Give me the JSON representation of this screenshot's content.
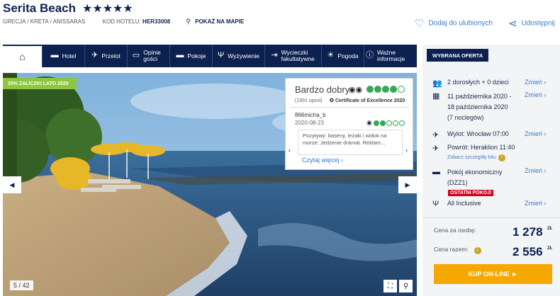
{
  "header": {
    "title": "Serita Beach",
    "stars": "★★★★★",
    "location": "GRECJA / KRETA / ANISSARAS",
    "hotel_code_label": "KOD HOTELU:",
    "hotel_code": "HER33008",
    "map_link": "POKAŻ NA MAPIE",
    "favorite": "Dodaj do ulubionych",
    "share": "Udostępnij"
  },
  "nav": {
    "items": [
      {
        "label": "Hotel",
        "icon": "bed-icon"
      },
      {
        "label": "Przelot",
        "icon": "plane-icon"
      },
      {
        "label": "Opinie gości",
        "icon": "speech-icon"
      },
      {
        "label": "Pokoje",
        "icon": "bed-icon"
      },
      {
        "label": "Wyżywienie",
        "icon": "cutlery-icon"
      },
      {
        "label": "Wycieczki fakultatywne",
        "icon": "signpost-icon"
      },
      {
        "label": "Pogoda",
        "icon": "sun-icon"
      },
      {
        "label": "Ważne informacje",
        "icon": "info-icon"
      }
    ]
  },
  "gallery": {
    "promo": "25% ZALICZKI LATO 2020",
    "counter": "5 / 42"
  },
  "review": {
    "rating_text": "Bardzo dobry",
    "rating": 4,
    "count": "(1991 opinii)",
    "certificate": "Certificate of Excellence 2020",
    "user": "866micha_b",
    "date": "2020-08-23",
    "user_rating": 2,
    "text": "Pozytywy: baseny, leżaki i widok na morze. Jedzenie dramat. Reklam...",
    "more": "Czytaj więcej"
  },
  "offer": {
    "heading": "WYBRANA OFERTA",
    "change": "Zmień",
    "guests": "2 dorosłych + 0 dzieci",
    "date_line1": "11 października 2020 -",
    "date_line2": "18 października 2020",
    "date_line3": "(7 noclegów)",
    "departure": "Wylot: Wrocław 07:00",
    "return": "Powrót: Heraklion 11:40",
    "flight_details": "Zobacz szczegóły lotu",
    "room_line1": "Pokój ekonomiczny",
    "room_line2": "(DZZ1)",
    "room_badge": "OSTATNI POKÓJ!",
    "board": "All Inclusive",
    "price_per_person_label": "Cena za osobę:",
    "price_per_person": "1 278",
    "price_total_label": "Cena razem:",
    "price_total": "2 556",
    "currency": "ZŁ",
    "buy": "KUP ON-LINE ►"
  }
}
